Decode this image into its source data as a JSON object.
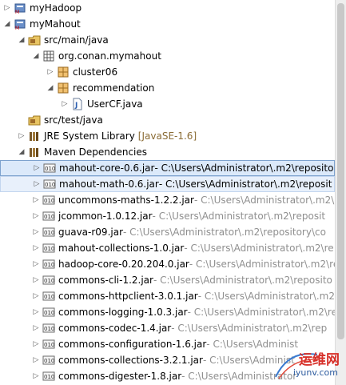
{
  "tree": {
    "projects": [
      {
        "label": "myHadoop",
        "expanded": false
      },
      {
        "label": "myMahout",
        "expanded": true
      }
    ],
    "src_main": "src/main/java",
    "package": "org.conan.mymahout",
    "cluster": "cluster06",
    "recommendation": "recommendation",
    "usercf": "UserCF.java",
    "src_test": "src/test/java",
    "jre_label": "JRE System Library",
    "jre_decoration": "[JavaSE-1.6]",
    "maven": "Maven Dependencies",
    "jars": [
      {
        "name": "mahout-core-0.6.jar",
        "path": " - C:\\Users\\Administrator\\.m2\\reposito"
      },
      {
        "name": "mahout-math-0.6.jar",
        "path": " - C:\\Users\\Administrator\\.m2\\reposit"
      },
      {
        "name": "uncommons-maths-1.2.2.jar",
        "path": " - C:\\Users\\Administrator\\.m2\\"
      },
      {
        "name": "jcommon-1.0.12.jar",
        "path": " - C:\\Users\\Administrator\\.m2\\reposit"
      },
      {
        "name": "guava-r09.jar",
        "path": " - C:\\Users\\Administrator\\.m2\\repository\\co"
      },
      {
        "name": "mahout-collections-1.0.jar",
        "path": " - C:\\Users\\Administrator\\.m2\\re"
      },
      {
        "name": "hadoop-core-0.20.204.0.jar",
        "path": " - C:\\Users\\Administrator\\.m2\\re"
      },
      {
        "name": "commons-cli-1.2.jar",
        "path": " - C:\\Users\\Administrator\\.m2\\reposito"
      },
      {
        "name": "commons-httpclient-3.0.1.jar",
        "path": " - C:\\Users\\Administrator\\.m2\\"
      },
      {
        "name": "commons-logging-1.0.3.jar",
        "path": " - C:\\Users\\Administrator\\.m2\\re"
      },
      {
        "name": "commons-codec-1.4.jar",
        "path": " - C:\\Users\\Administrator\\.m2\\rep"
      },
      {
        "name": "commons-configuration-1.6.jar",
        "path": " - C:\\Users\\Administ"
      },
      {
        "name": "commons-collections-3.2.1.jar",
        "path": " - C:\\Users\\Administ"
      },
      {
        "name": "commons-digester-1.8.jar",
        "path": " - C:\\Users\\Administrator"
      }
    ]
  },
  "watermark": {
    "big": "运维网",
    "small": "iyunv.com"
  },
  "colors": {
    "selection": "#dbe9fa",
    "decoration": "#8f8f8f",
    "jre_decoration": "#8b6c35"
  }
}
